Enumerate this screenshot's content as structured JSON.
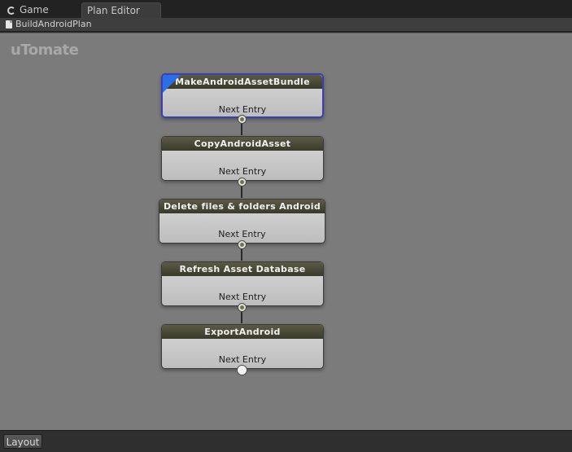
{
  "tabs": {
    "game": "Game",
    "plan_editor": "Plan Editor"
  },
  "toolbar": {
    "plan_name": "BuildAndroidPlan"
  },
  "canvas": {
    "brand": "uTomate",
    "nodes": [
      {
        "title": "MakeAndroidAssetBundle",
        "entry": "Next Entry",
        "selected": true
      },
      {
        "title": "CopyAndroidAsset",
        "entry": "Next Entry",
        "selected": false
      },
      {
        "title": "Delete files & folders Android",
        "entry": "Next Entry",
        "selected": false
      },
      {
        "title": "Refresh Asset Database",
        "entry": "Next Entry",
        "selected": false
      },
      {
        "title": "ExportAndroid",
        "entry": "Next Entry",
        "selected": false
      }
    ]
  },
  "bottombar": {
    "layout_label": "Layout"
  },
  "colors": {
    "canvas_bg": "#7b7b7b",
    "node_header": "#4a4a38",
    "selection_border": "#3a3fb3",
    "selection_flag": "#2b6fe8"
  }
}
